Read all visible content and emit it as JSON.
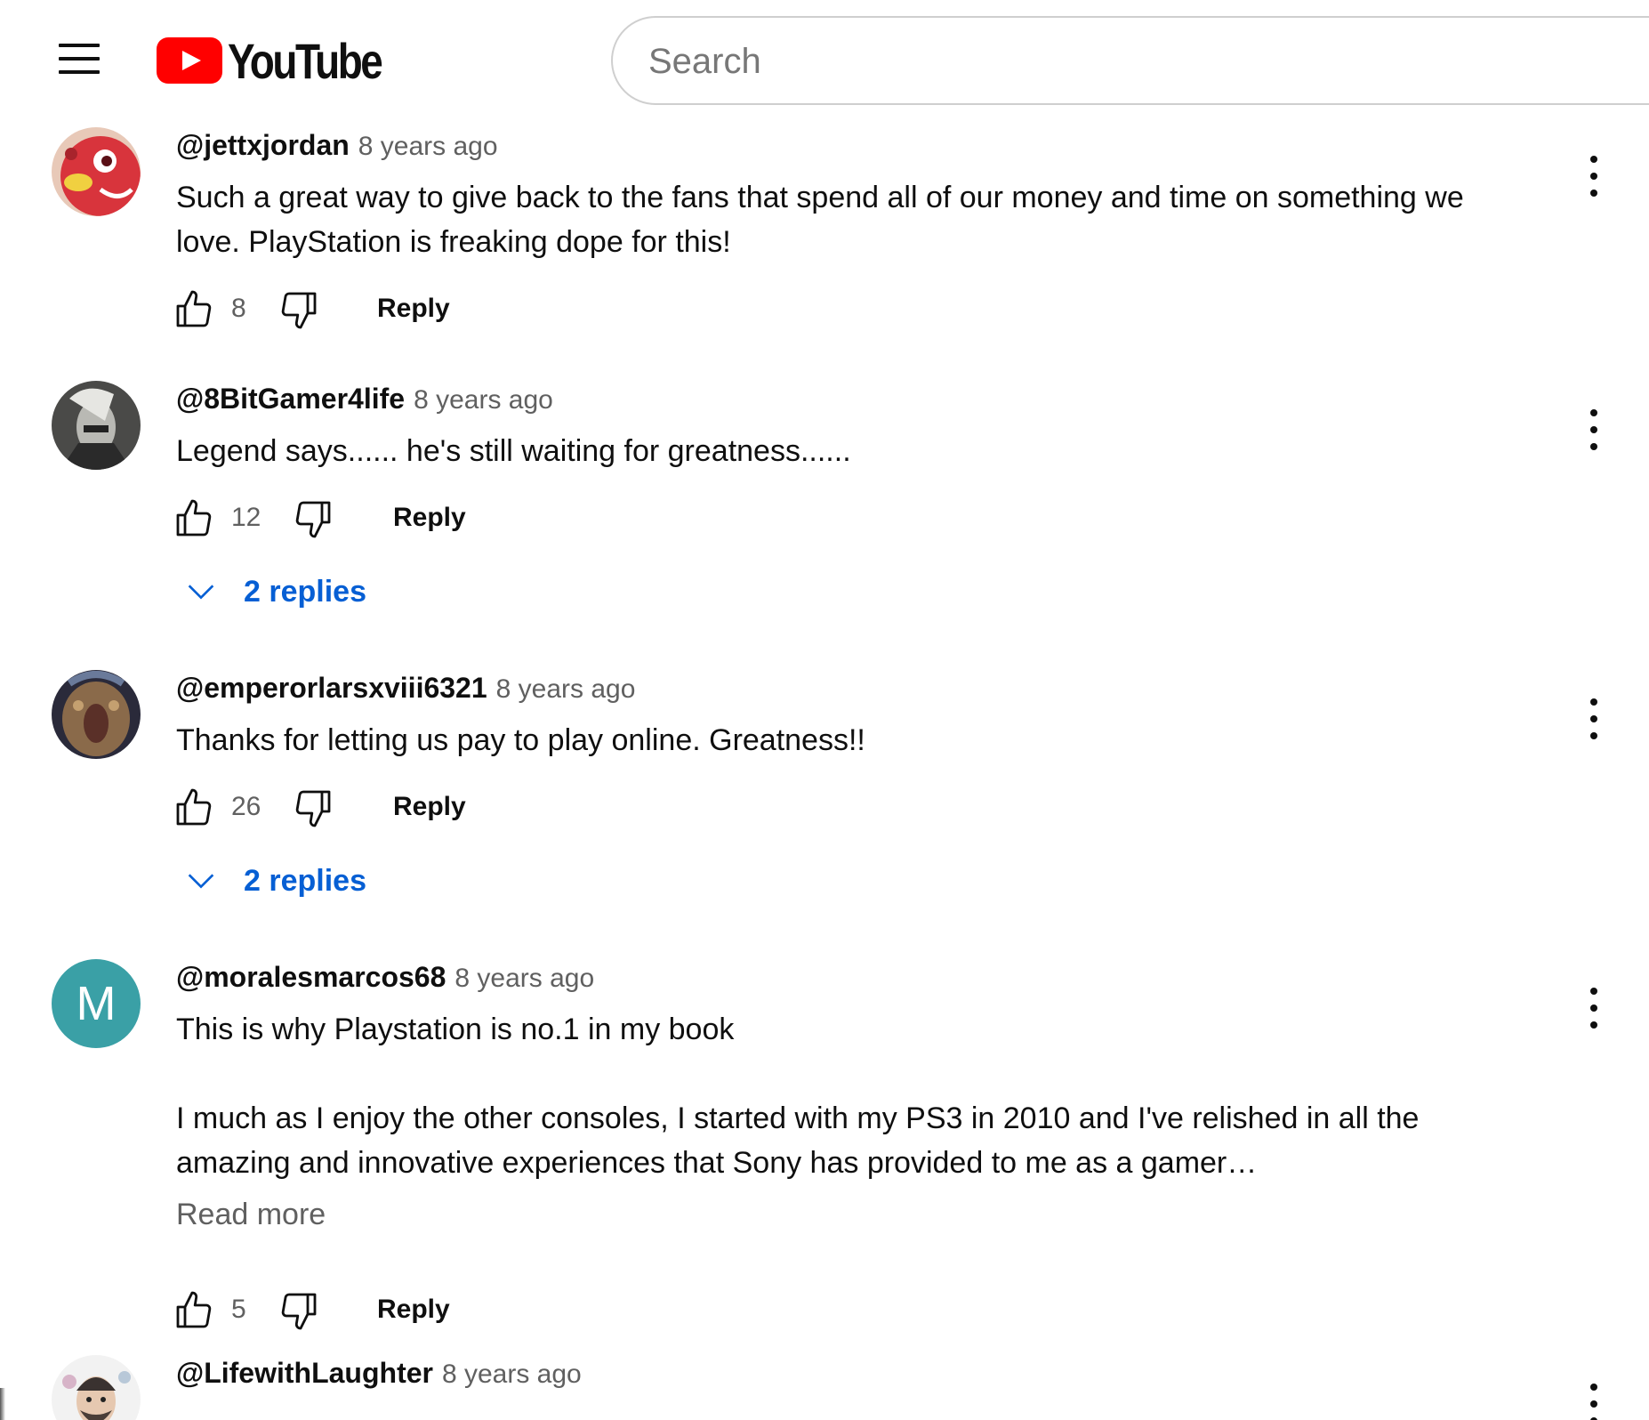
{
  "header": {
    "logo_text": "YouTube",
    "search_placeholder": "Search"
  },
  "reply_label": "Reply",
  "comments": [
    {
      "author": "@jettxjordan",
      "time": "8 years ago",
      "text": [
        "Such a great way to give back to the fans that spend all of our money and time on something we",
        "love. PlayStation is freaking dope for this!"
      ],
      "likes": "8"
    },
    {
      "author": "@8BitGamer4life",
      "time": "8 years ago",
      "text": [
        "Legend says...... he's still waiting for greatness......"
      ],
      "likes": "12",
      "replies": "2 replies"
    },
    {
      "author": "@emperorlarsxviii6321",
      "time": "8 years ago",
      "text": [
        "Thanks for letting us pay to play online. Greatness!!"
      ],
      "likes": "26",
      "replies": "2 replies"
    },
    {
      "author": "@moralesmarcos68",
      "avatar_letter": "M",
      "time": "8 years ago",
      "text": [
        "This is why Playstation is no.1 in my book",
        "",
        "I much as I enjoy the other consoles, I started with my PS3 in 2010 and I've relished in all the",
        "amazing and innovative experiences that Sony has provided to me as a gamer…"
      ],
      "read_more": "Read more",
      "likes": "5"
    },
    {
      "author": "@LifewithLaughter",
      "time": "8 years ago"
    }
  ],
  "colors": {
    "brand_red": "#ff0000",
    "link_blue": "#065fd4",
    "secondary_text": "#606060",
    "avatar_teal": "#3aa0a6"
  }
}
